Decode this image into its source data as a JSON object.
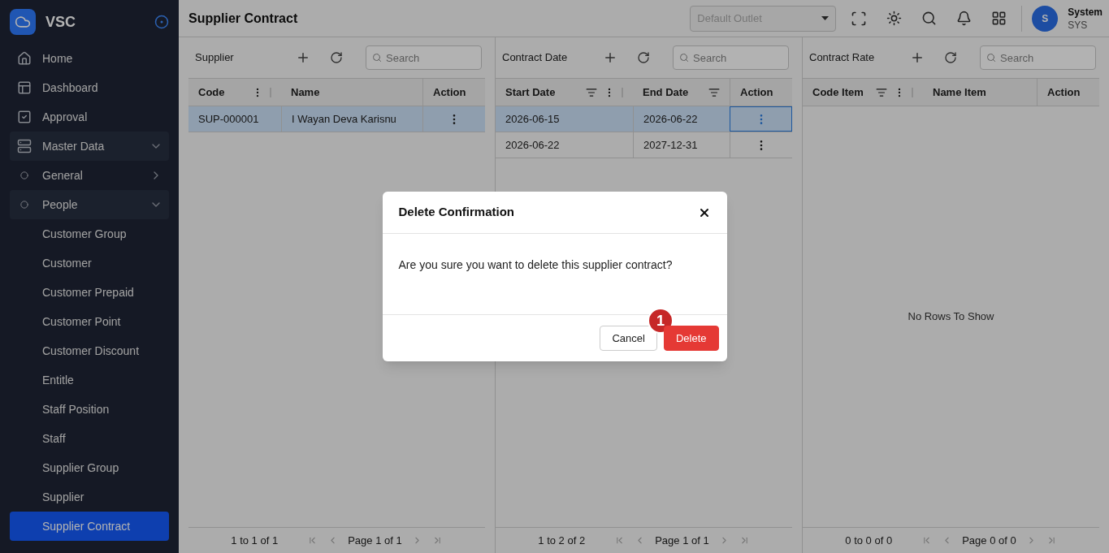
{
  "sidebar": {
    "brand": "VSC",
    "items": [
      {
        "label": "Home",
        "kind": "home",
        "selected": false
      },
      {
        "label": "Dashboard",
        "kind": "dashboard",
        "selected": false
      },
      {
        "label": "Approval",
        "kind": "approval",
        "selected": false
      },
      {
        "label": "Master Data",
        "kind": "database",
        "selected": false,
        "expanded": true,
        "children": [
          {
            "label": "General",
            "kind": "dot",
            "selected": false,
            "expanded": false
          },
          {
            "label": "People",
            "kind": "dot",
            "selected": false,
            "expanded": true,
            "children": [
              {
                "label": "Customer Group",
                "selected": false
              },
              {
                "label": "Customer",
                "selected": false
              },
              {
                "label": "Customer Prepaid",
                "selected": false
              },
              {
                "label": "Customer Point",
                "selected": false
              },
              {
                "label": "Customer Discount",
                "selected": false
              },
              {
                "label": "Entitle",
                "selected": false
              },
              {
                "label": "Staff Position",
                "selected": false
              },
              {
                "label": "Staff",
                "selected": false
              },
              {
                "label": "Supplier Group",
                "selected": false
              },
              {
                "label": "Supplier",
                "selected": false
              },
              {
                "label": "Supplier Contract",
                "selected": true
              }
            ]
          }
        ]
      }
    ]
  },
  "header": {
    "title": "Supplier Contract",
    "outlet_select": {
      "placeholder": "Default Outlet"
    },
    "user": {
      "initial": "S",
      "name": "System",
      "code": "SYS"
    }
  },
  "panels": [
    {
      "title": "Supplier",
      "search": {
        "placeholder": "Search"
      },
      "columns": [
        {
          "label": "Code",
          "menu": true
        },
        {
          "label": "Name"
        },
        {
          "label": "Action"
        }
      ],
      "rows": [
        {
          "cells": [
            "SUP-000001",
            "I Wayan Deva Karisnu"
          ],
          "selected": true,
          "action_focused": false
        }
      ],
      "pagination": {
        "range": "1 to 1 of 1",
        "page": "Page 1 of 1"
      }
    },
    {
      "title": "Contract Date",
      "search": {
        "placeholder": "Search"
      },
      "columns": [
        {
          "label": "Start Date",
          "filter": true,
          "menu": true
        },
        {
          "label": "End Date",
          "filter": true
        },
        {
          "label": "Action"
        }
      ],
      "rows": [
        {
          "cells": [
            "2026-06-15",
            "2026-06-22"
          ],
          "selected": true,
          "action_focused": true
        },
        {
          "cells": [
            "2026-06-22",
            "2027-12-31"
          ],
          "selected": false,
          "action_focused": false
        }
      ],
      "pagination": {
        "range": "1 to 2 of 2",
        "page": "Page 1 of 1"
      }
    },
    {
      "title": "Contract Rate",
      "search": {
        "placeholder": "Search"
      },
      "columns": [
        {
          "label": "Code Item",
          "filter": true,
          "menu": true
        },
        {
          "label": "Name Item"
        },
        {
          "label": "Action"
        }
      ],
      "empty_text": "No Rows To Show",
      "pagination": {
        "range": "0 to 0 of 0",
        "page": "Page 0 of 0"
      }
    }
  ],
  "dialog": {
    "title": "Delete Confirmation",
    "message": "Are you sure you want to delete this supplier contract?",
    "buttons": [
      {
        "label": "Cancel",
        "kind": "secondary"
      },
      {
        "label": "Delete",
        "kind": "danger"
      }
    ],
    "marker": "1"
  }
}
